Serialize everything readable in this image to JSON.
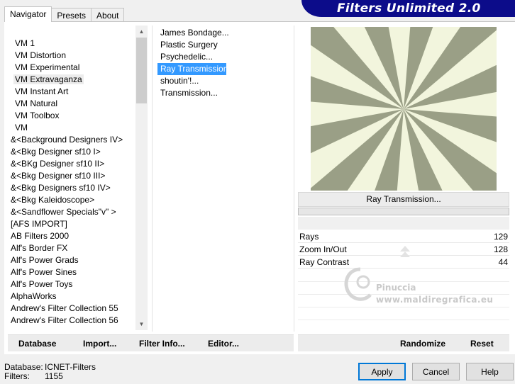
{
  "title": "Filters Unlimited 2.0",
  "tabs": [
    "Navigator",
    "Presets",
    "About"
  ],
  "categories": [
    "VM 1",
    "VM Distortion",
    "VM Experimental",
    "VM Extravaganza",
    "VM Instant Art",
    "VM Natural",
    "VM Toolbox",
    "VM",
    "&<Background Designers IV>",
    "&<Bkg Designer sf10 I>",
    "&<BKg Designer sf10 II>",
    "&<Bkg Designer sf10 III>",
    "&<Bkg Designers sf10 IV>",
    "&<Bkg Kaleidoscope>",
    "&<Sandflower Specials\"v\" >",
    "[AFS IMPORT]",
    "AB Filters 2000",
    "Alf's Border FX",
    "Alf's Power Grads",
    "Alf's Power Sines",
    "Alf's Power Toys",
    "AlphaWorks",
    "Andrew's Filter Collection 55",
    "Andrew's Filter Collection 56"
  ],
  "highlighted_category": "VM Extravaganza",
  "filters": [
    "James Bondage...",
    "Plastic Surgery",
    "Psychedelic...",
    "Ray Transmission...",
    "shoutin'!...",
    "Transmission..."
  ],
  "selected_filter": "Ray Transmission...",
  "preview": {
    "caption": "Ray Transmission...",
    "color_light": "#f2f5dd",
    "color_dark": "#9a9f86"
  },
  "params": [
    {
      "name": "Rays",
      "value": "129"
    },
    {
      "name": "Zoom In/Out",
      "value": "128"
    },
    {
      "name": "Ray Contrast",
      "value": "44"
    }
  ],
  "watermark": {
    "line1": "Pinuccia",
    "line2": "www.maldiregrafica.eu"
  },
  "links_left": {
    "database": "Database",
    "import": "Import...",
    "filter_info": "Filter Info...",
    "editor": "Editor..."
  },
  "links_right": {
    "randomize": "Randomize",
    "reset": "Reset"
  },
  "footer": {
    "database_label": "Database:",
    "database_value": "ICNET-Filters",
    "filters_label": "Filters:",
    "filters_value": "1155"
  },
  "buttons": {
    "apply": "Apply",
    "cancel": "Cancel",
    "help": "Help"
  }
}
